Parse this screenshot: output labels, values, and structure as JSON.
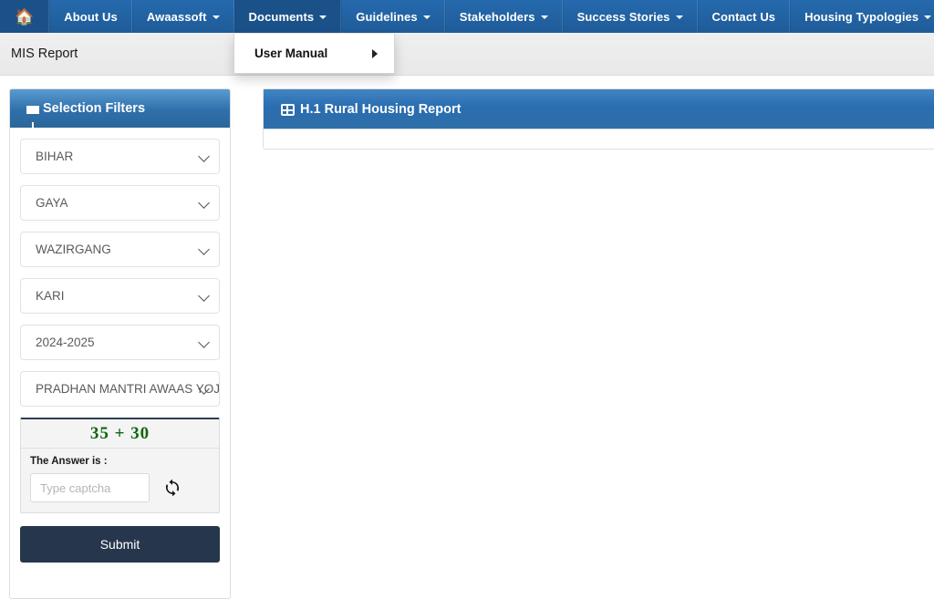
{
  "navbar": {
    "home_icon": "home-icon",
    "items": [
      {
        "label": "About Us",
        "caret": false
      },
      {
        "label": "Awaassoft",
        "caret": true
      },
      {
        "label": "Documents",
        "caret": true,
        "open": true
      },
      {
        "label": "Guidelines",
        "caret": true
      },
      {
        "label": "Stakeholders",
        "caret": true
      },
      {
        "label": "Success Stories",
        "caret": true
      },
      {
        "label": "Contact Us",
        "caret": false
      },
      {
        "label": "Housing Typologies",
        "caret": true
      }
    ]
  },
  "dropdown": {
    "items": [
      {
        "label": "User Manual",
        "has_submenu": true
      }
    ]
  },
  "breadcrumb": {
    "text": "MIS Report"
  },
  "sidebar": {
    "title": "Selection Filters",
    "filter_icon": "funnel-icon",
    "filters": [
      {
        "name": "state",
        "value": "BIHAR"
      },
      {
        "name": "district",
        "value": "GAYA"
      },
      {
        "name": "block",
        "value": "WAZIRGANG"
      },
      {
        "name": "panchayat",
        "value": "KARI"
      },
      {
        "name": "financial-year",
        "value": "2024-2025"
      },
      {
        "name": "scheme",
        "value": "PRADHAN MANTRI AWAAS YOJANA - GRAMIN"
      }
    ],
    "captcha": {
      "question": "35 + 30",
      "label": "The Answer is :",
      "input_value": "",
      "placeholder": "Type captcha",
      "refresh_icon": "refresh-icon"
    },
    "submit_label": "Submit"
  },
  "report": {
    "icon": "table-grid-icon",
    "title": "H.1 Rural Housing Report"
  },
  "colors": {
    "nav_blue": "#1f5b98",
    "panel_blue": "#2a6db0",
    "submit_dark": "#26374d",
    "captcha_green": "#116611"
  }
}
